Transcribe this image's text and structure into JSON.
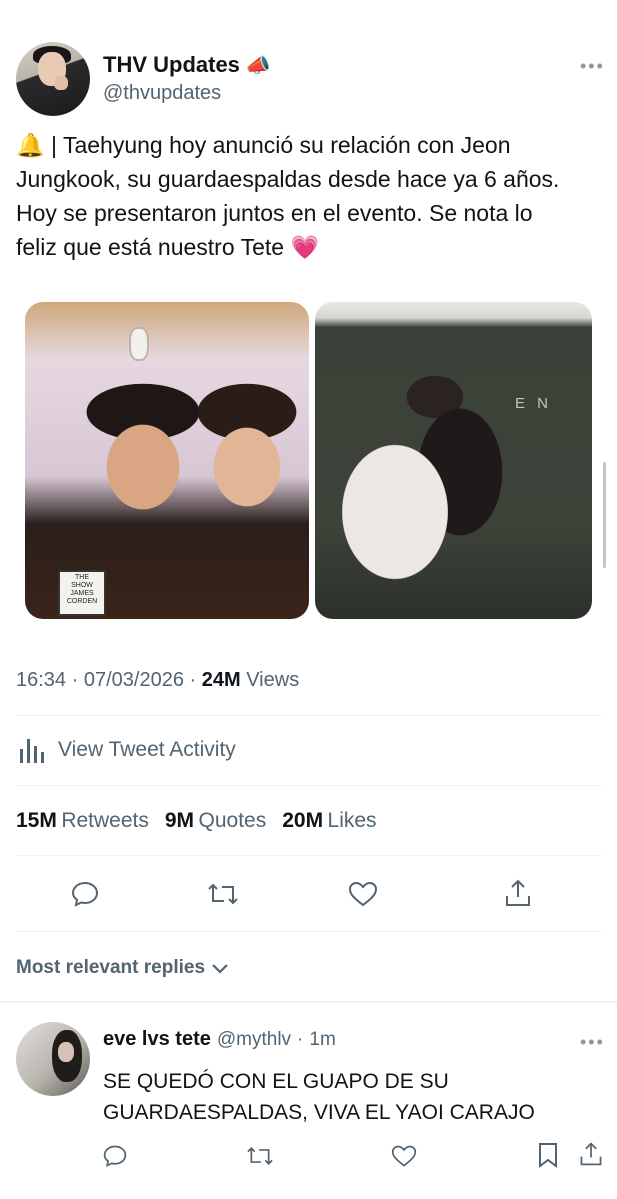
{
  "author": {
    "display_name": "THV Updates",
    "badge_emoji": "📣",
    "handle": "@thvupdates"
  },
  "tweet": {
    "lines": [
      "🔔 | Taehyung hoy anunció su relación con Jeon",
      "Jungkook, su guardaespaldas desde hace ya 6 años.",
      "Hoy se presentaron juntos en el evento. Se nota lo",
      "feliz que está nuestro Tete 💗"
    ],
    "time": "16:34",
    "date": "07/03/2026",
    "views_count": "24M",
    "views_label": "Views"
  },
  "photos": {
    "photo1_sign_lines": [
      "THE",
      "LATE",
      "SHOW",
      "JAMES",
      "CORDEN"
    ],
    "photo2_wall_text": "E N"
  },
  "activity": {
    "label": "View Tweet Activity"
  },
  "stats": [
    {
      "count": "15M",
      "label": "Retweets"
    },
    {
      "count": "9M",
      "label": "Quotes"
    },
    {
      "count": "20M",
      "label": "Likes"
    }
  ],
  "actions": [
    "reply-icon",
    "retweet-icon",
    "like-icon",
    "share-icon"
  ],
  "replies_header": {
    "label": "Most relevant replies"
  },
  "reply": {
    "display_name": "eve lvs tete",
    "handle": "@mythlv",
    "separator": "·",
    "time": "1m",
    "lines": [
      "SE QUEDÓ CON EL GUAPO DE SU",
      "GUARDAESPALDAS, VIVA EL YAOI CARAJO"
    ]
  },
  "colors": {
    "text": "#0f1419",
    "secondary": "#536471",
    "divider": "#eff3f4"
  }
}
